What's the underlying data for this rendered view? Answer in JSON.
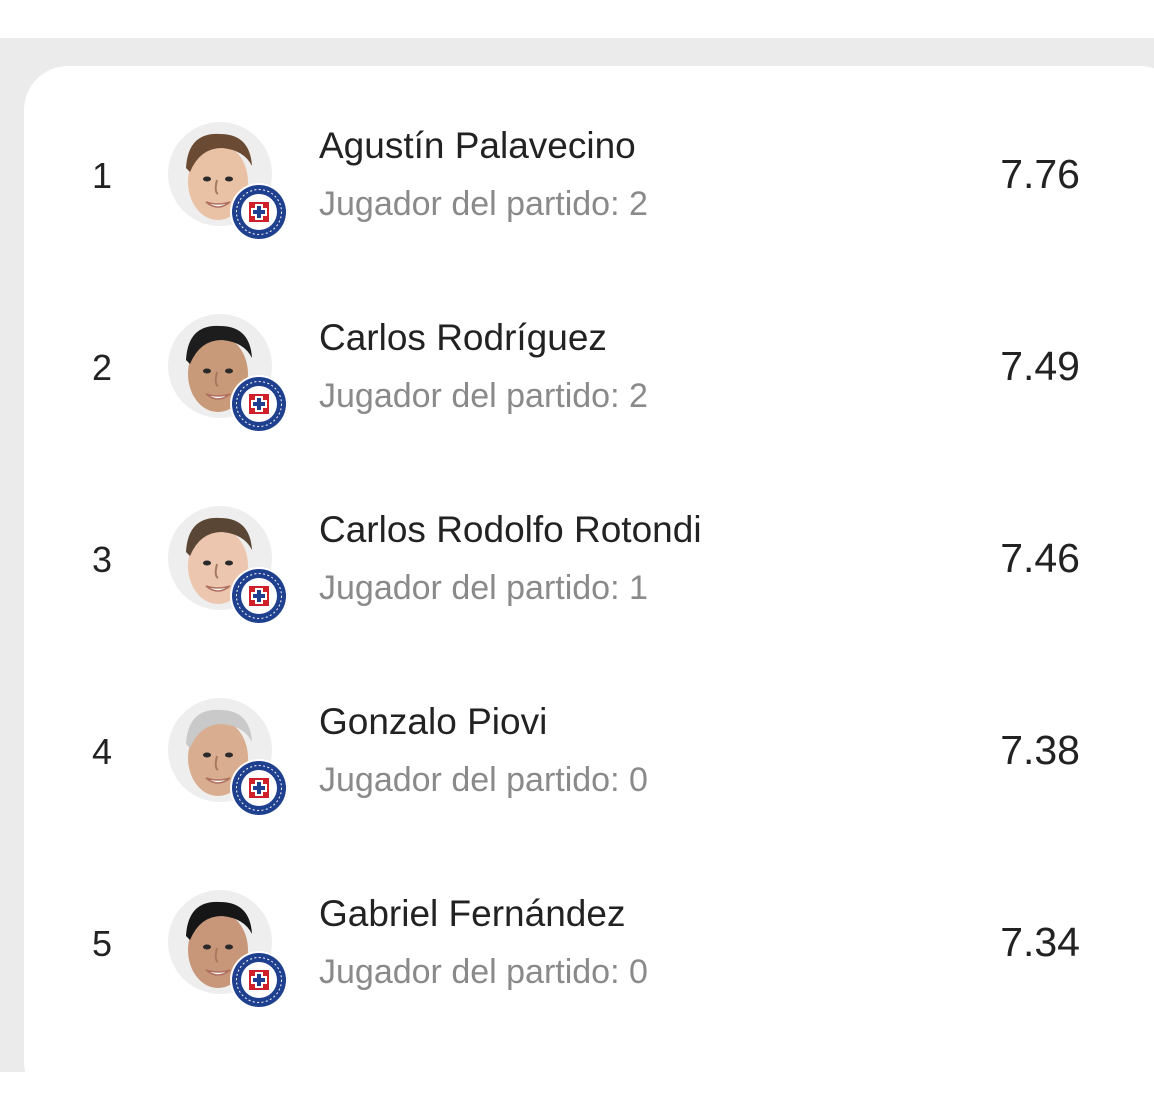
{
  "players": [
    {
      "rank": "1",
      "name": "Agustín Palavecino",
      "subtitle": "Jugador del partido: 2",
      "rating": "7.76",
      "hair": "#6a4a32",
      "skin": "#e9c2a6"
    },
    {
      "rank": "2",
      "name": "Carlos Rodríguez",
      "subtitle": "Jugador del partido: 2",
      "rating": "7.49",
      "hair": "#1d1d1d",
      "skin": "#c99a79"
    },
    {
      "rank": "3",
      "name": "Carlos Rodolfo Rotondi",
      "subtitle": "Jugador del partido: 1",
      "rating": "7.46",
      "hair": "#5a4634",
      "skin": "#ecc6ae"
    },
    {
      "rank": "4",
      "name": "Gonzalo Piovi",
      "subtitle": "Jugador del partido: 0",
      "rating": "7.38",
      "hair": "#c9c9c9",
      "skin": "#d9ad8f"
    },
    {
      "rank": "5",
      "name": "Gabriel Fernández",
      "subtitle": "Jugador del partido: 0",
      "rating": "7.34",
      "hair": "#161616",
      "skin": "#c8977a"
    }
  ],
  "colors": {
    "card": "#ffffff",
    "background": "#ebebeb",
    "badge_blue": "#1f3f8f",
    "badge_red": "#d0202a",
    "avatar_bg": "#eeeeee",
    "text_primary": "#222222",
    "text_secondary": "#8a8a8a"
  },
  "icons": {
    "avatar": "player-photo",
    "badge": "team-crest-cruz-azul"
  }
}
